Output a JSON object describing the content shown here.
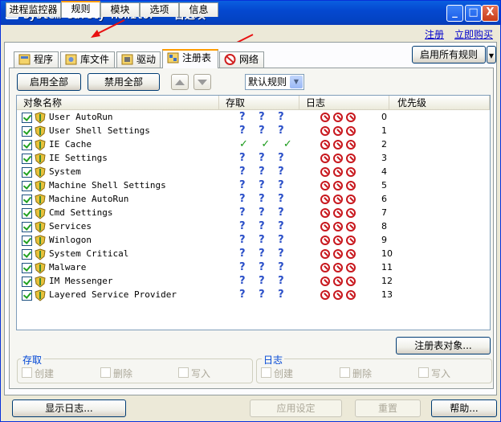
{
  "window": {
    "title": "System Safety Monitor — 首选项",
    "controls": {
      "minimize": "_",
      "maximize": "□",
      "close": "X"
    }
  },
  "main_tabs": [
    "进程监控器",
    "规则",
    "模块",
    "选项",
    "信息"
  ],
  "active_main_tab": "规则",
  "top_links": {
    "register": "注册",
    "buy": "立即购买"
  },
  "enable_all_rules_button": "启用所有规则",
  "sub_tabs": [
    "程序",
    "库文件",
    "驱动",
    "注册表",
    "网络"
  ],
  "active_sub_tab": "注册表",
  "toolbar": {
    "enable_all": "启用全部",
    "disable_all": "禁用全部",
    "rule_select_value": "默认规则",
    "move_up_icon": "up-arrow",
    "move_down_icon": "down-arrow"
  },
  "list": {
    "columns": [
      "对象名称",
      "存取",
      "日志",
      "优先级"
    ],
    "rows": [
      {
        "name": "User AutoRun",
        "access": "? ? ?",
        "priority": "0"
      },
      {
        "name": "User Shell Settings",
        "access": "? ? ?",
        "priority": "1"
      },
      {
        "name": "IE Cache",
        "access": "✓ ✓ ✓",
        "priority": "2",
        "allowed": true
      },
      {
        "name": "IE Settings",
        "access": "? ? ?",
        "priority": "3"
      },
      {
        "name": "System",
        "access": "? ? ?",
        "priority": "4"
      },
      {
        "name": "Machine Shell Settings",
        "access": "? ? ?",
        "priority": "5"
      },
      {
        "name": "Machine AutoRun",
        "access": "? ? ?",
        "priority": "6"
      },
      {
        "name": "Cmd Settings",
        "access": "? ? ?",
        "priority": "7"
      },
      {
        "name": "Services",
        "access": "? ? ?",
        "priority": "8"
      },
      {
        "name": "Winlogon",
        "access": "? ? ?",
        "priority": "9"
      },
      {
        "name": "System Critical",
        "access": "? ? ?",
        "priority": "10"
      },
      {
        "name": "Malware",
        "access": "? ? ?",
        "priority": "11"
      },
      {
        "name": "IM Messenger",
        "access": "? ? ?",
        "priority": "12"
      },
      {
        "name": "Layered Service Provider",
        "access": "? ? ?",
        "priority": "13"
      }
    ]
  },
  "registry_objects_button": "注册表对象...",
  "access_group": {
    "title": "存取",
    "options": [
      "创建",
      "删除",
      "写入"
    ]
  },
  "log_group": {
    "title": "日志",
    "options": [
      "创建",
      "删除",
      "写入"
    ]
  },
  "footer": {
    "show_log": "显示日志...",
    "apply": "应用设定",
    "reset": "重置",
    "help": "帮助..."
  }
}
